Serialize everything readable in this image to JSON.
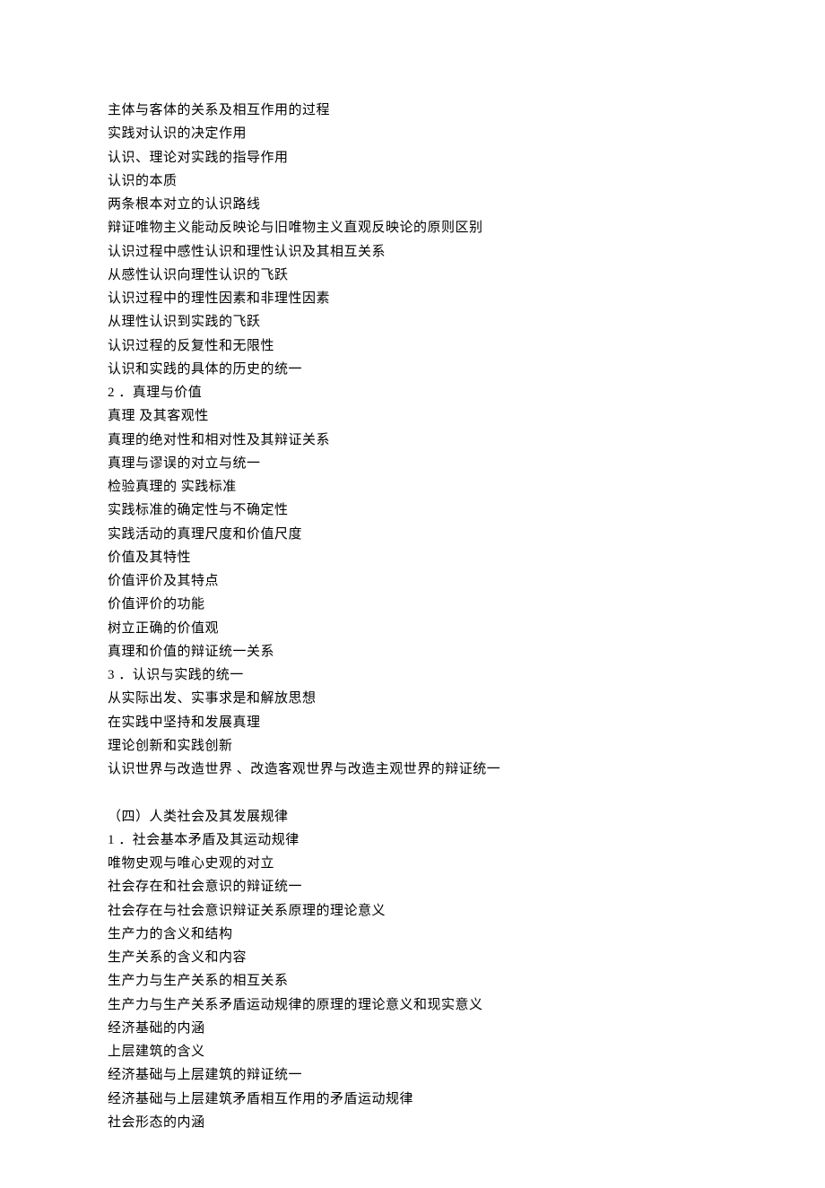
{
  "lines": [
    "主体与客体的关系及相互作用的过程",
    "实践对认识的决定作用",
    "认识、理论对实践的指导作用",
    "认识的本质",
    "两条根本对立的认识路线",
    "辩证唯物主义能动反映论与旧唯物主义直观反映论的原则区别",
    "认识过程中感性认识和理性认识及其相互关系",
    "从感性认识向理性认识的飞跃",
    "认识过程中的理性因素和非理性因素",
    "从理性认识到实践的飞跃",
    "认识过程的反复性和无限性",
    "认识和实践的具体的历史的统一",
    "2 ．真理与价值",
    "真理 及其客观性",
    "真理的绝对性和相对性及其辩证关系",
    "真理与谬误的对立与统一",
    "检验真理的 实践标准",
    "实践标准的确定性与不确定性",
    "实践活动的真理尺度和价值尺度",
    "价值及其特性",
    "价值评价及其特点",
    "价值评价的功能",
    "树立正确的价值观",
    "真理和价值的辩证统一关系",
    "3 ．认识与实践的统一",
    "从实际出发、实事求是和解放思想",
    "在实践中坚持和发展真理",
    "理论创新和实践创新",
    "认识世界与改造世界 、改造客观世界与改造主观世界的辩证统一",
    "",
    "（四）人类社会及其发展规律",
    "1 ．社会基本矛盾及其运动规律",
    "唯物史观与唯心史观的对立",
    "社会存在和社会意识的辩证统一",
    "社会存在与社会意识辩证关系原理的理论意义",
    "生产力的含义和结构",
    "生产关系的含义和内容",
    "生产力与生产关系的相互关系",
    "生产力与生产关系矛盾运动规律的原理的理论意义和现实意义",
    "经济基础的内涵",
    "上层建筑的含义",
    "经济基础与上层建筑的辩证统一",
    "经济基础与上层建筑矛盾相互作用的矛盾运动规律",
    "社会形态的内涵"
  ]
}
